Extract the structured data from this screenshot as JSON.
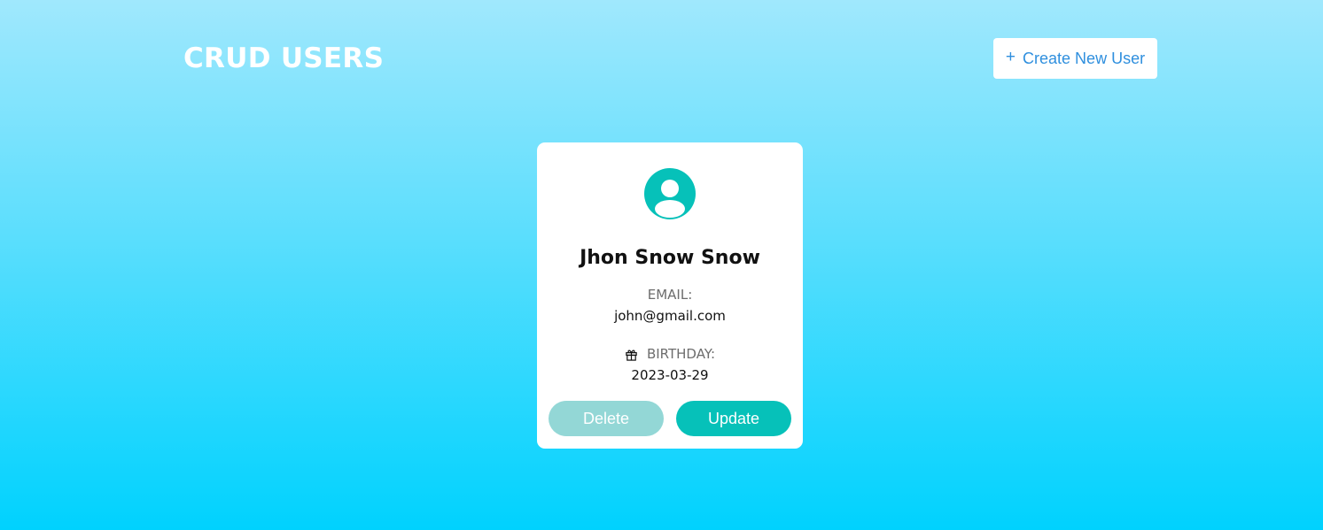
{
  "header": {
    "title": "CRUD USERS",
    "create_button": {
      "icon": "plus-icon",
      "icon_glyph": "+",
      "label": "Create New User"
    }
  },
  "users": [
    {
      "avatar_icon": "user-circle-icon",
      "name": "Jhon Snow Snow",
      "email_label": "EMAIL:",
      "email": "john@gmail.com",
      "birthday_icon": "gift-icon",
      "birthday_label": "BIRTHDAY:",
      "birthday": "2023-03-29",
      "delete_label": "Delete",
      "update_label": "Update"
    }
  ],
  "colors": {
    "accent": "#06c1b9",
    "accent_muted": "#93d7d6",
    "link_blue": "#2f8fde",
    "background_top": "#a0e8fd",
    "background_bottom": "#00d2fe"
  }
}
